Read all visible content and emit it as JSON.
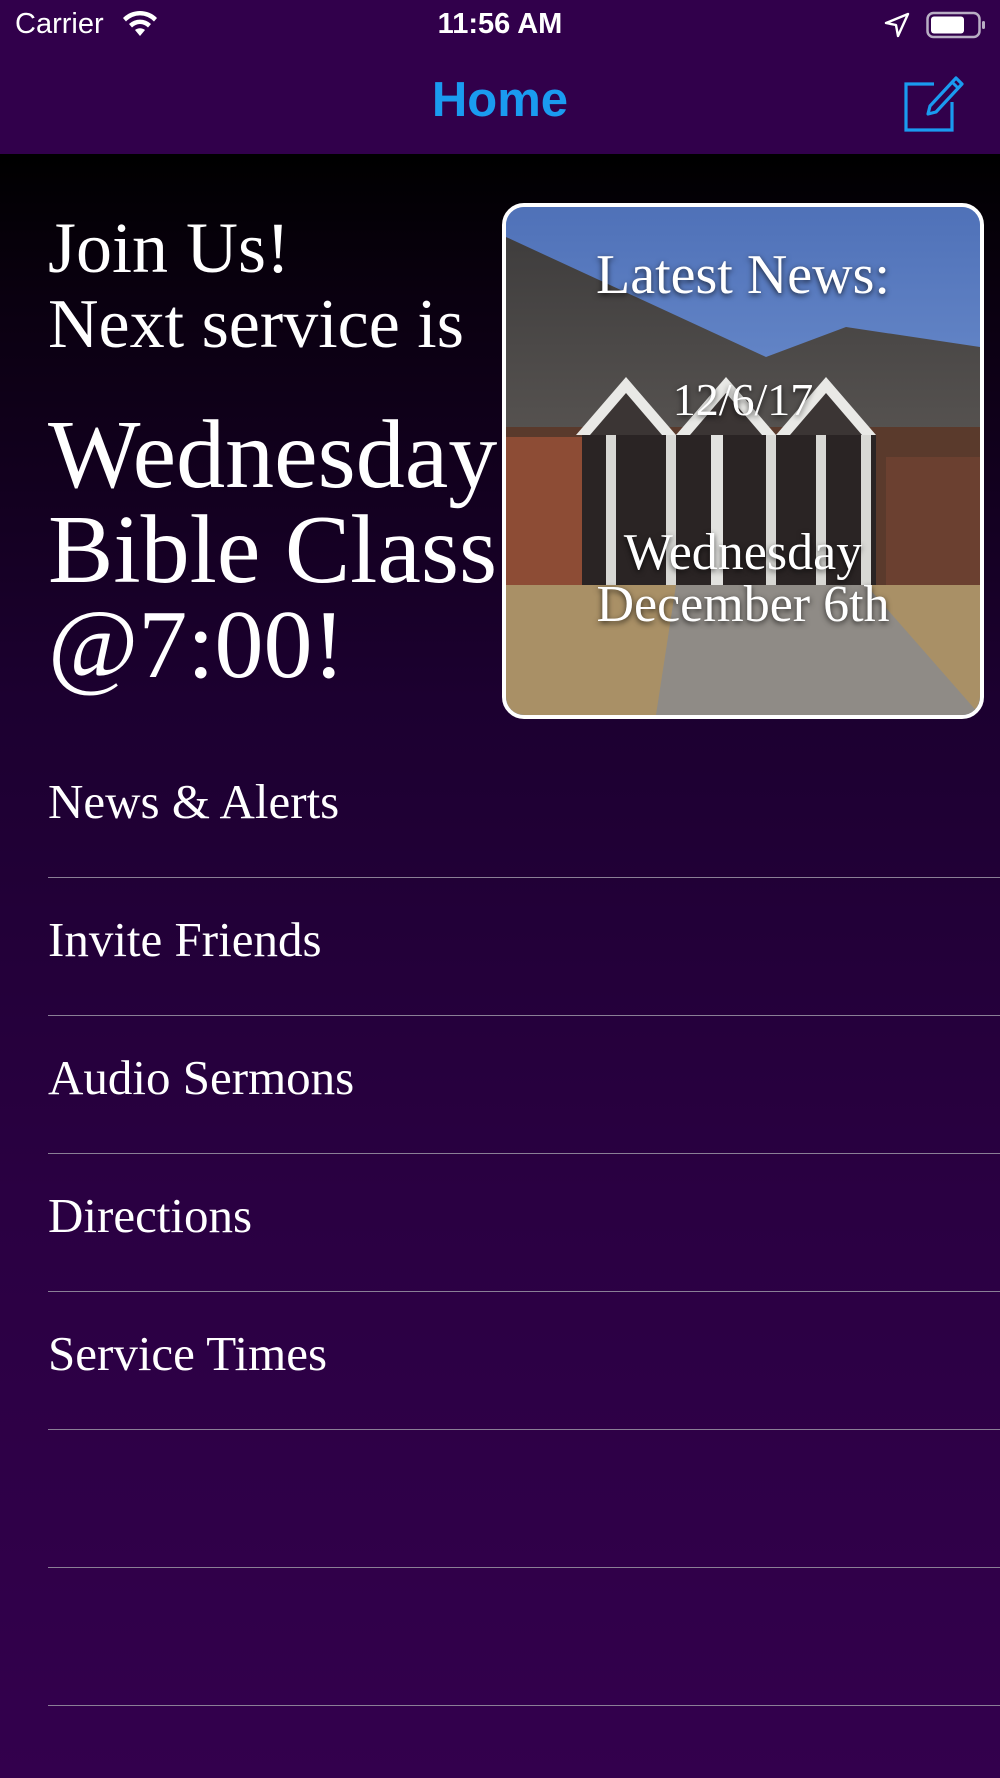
{
  "status_bar": {
    "carrier": "Carrier",
    "time": "11:56 AM",
    "icons": [
      "wifi-icon",
      "location-arrow-icon",
      "battery-icon"
    ]
  },
  "nav": {
    "title": "Home",
    "right_icon": "compose-icon",
    "title_color": "#1a9bf0"
  },
  "hero": {
    "join": "Join Us!",
    "next": "Next service is",
    "service_name": "Wednesday Bible Class @7:00!"
  },
  "news_card": {
    "heading": "Latest News:",
    "date": "12/6/17",
    "description_line1": "Wednesday",
    "description_line2": "December 6th"
  },
  "menu": {
    "items": [
      {
        "label": "News & Alerts"
      },
      {
        "label": "Invite Friends"
      },
      {
        "label": "Audio Sermons"
      },
      {
        "label": "Directions"
      },
      {
        "label": "Service Times"
      },
      {
        "label": ""
      },
      {
        "label": ""
      }
    ]
  },
  "colors": {
    "nav_background": "#31004b",
    "text": "#ffffff",
    "separator": "#8a7f96"
  }
}
